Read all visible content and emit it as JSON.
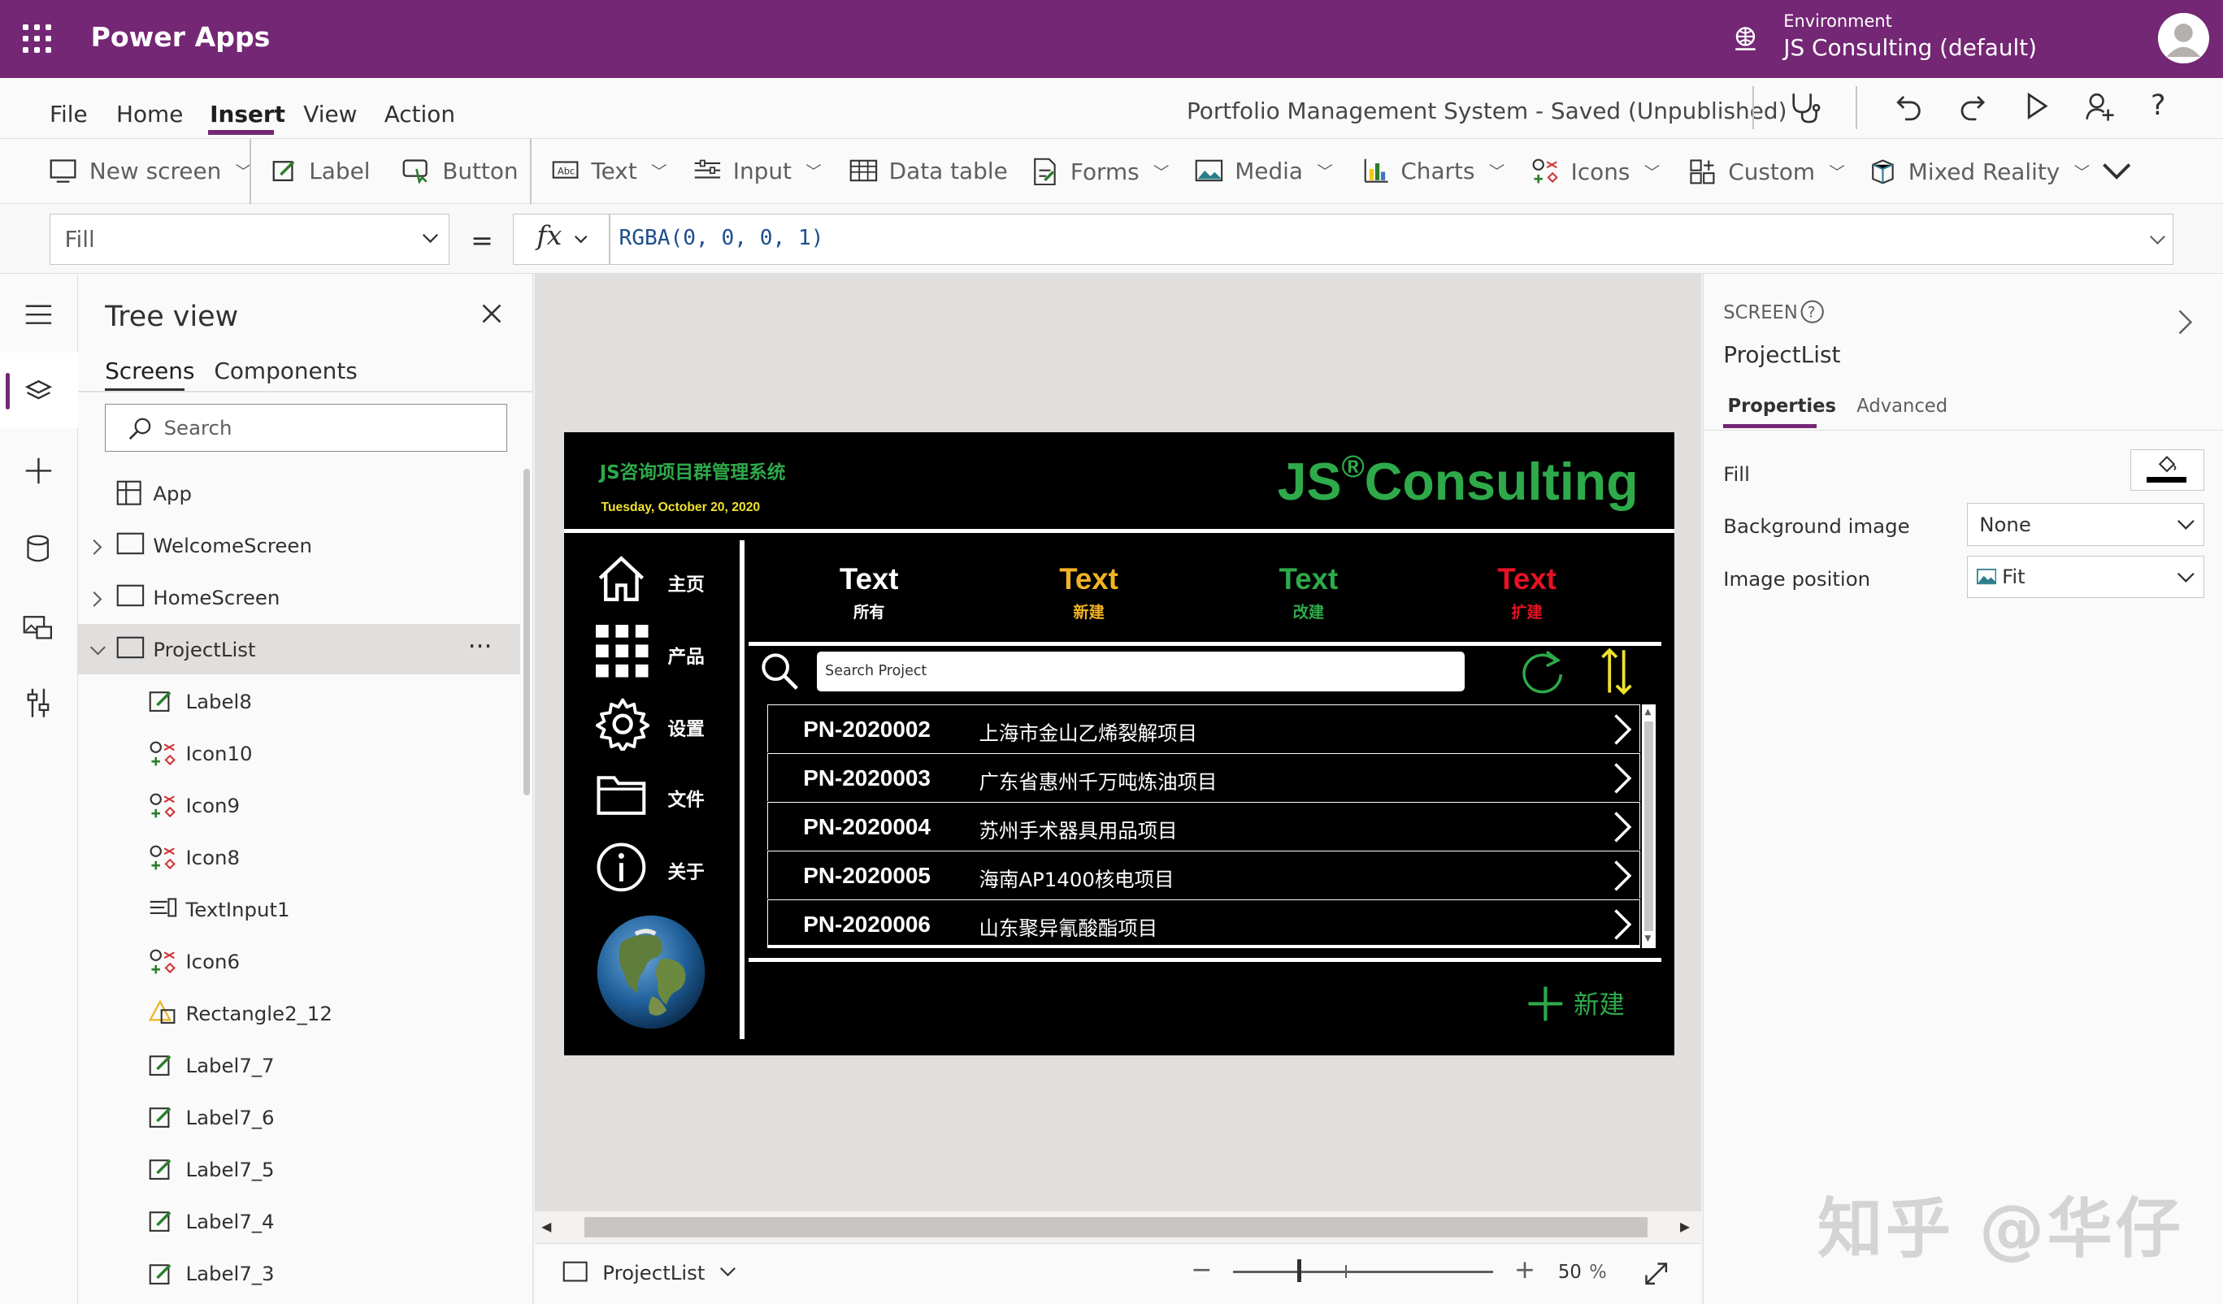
{
  "app": {
    "title": "Power Apps",
    "env_label": "Environment",
    "env_name": "JS Consulting (default)"
  },
  "menu": {
    "items": [
      "File",
      "Home",
      "Insert",
      "View",
      "Action"
    ],
    "active": "Insert",
    "doc_title": "Portfolio Management System - Saved (Unpublished)"
  },
  "ribbon": {
    "new_screen": "New screen",
    "label": "Label",
    "button": "Button",
    "text": "Text",
    "input": "Input",
    "data_table": "Data table",
    "forms": "Forms",
    "media": "Media",
    "charts": "Charts",
    "icons": "Icons",
    "custom": "Custom",
    "mixed_reality": "Mixed Reality"
  },
  "formula": {
    "property": "Fill",
    "eq": "=",
    "fx": "fx",
    "value": "RGBA(0, 0, 0, 1)"
  },
  "tree": {
    "title": "Tree view",
    "tabs": [
      "Screens",
      "Components"
    ],
    "search_placeholder": "Search",
    "items": [
      {
        "name": "App",
        "type": "app",
        "indent": 0
      },
      {
        "name": "WelcomeScreen",
        "type": "screen",
        "indent": 0,
        "expander": "right"
      },
      {
        "name": "HomeScreen",
        "type": "screen",
        "indent": 0,
        "expander": "right"
      },
      {
        "name": "ProjectList",
        "type": "screen",
        "indent": 0,
        "expander": "down",
        "selected": true,
        "more": "···"
      },
      {
        "name": "Label8",
        "type": "label",
        "indent": 1
      },
      {
        "name": "Icon10",
        "type": "icon",
        "indent": 1
      },
      {
        "name": "Icon9",
        "type": "icon",
        "indent": 1
      },
      {
        "name": "Icon8",
        "type": "icon",
        "indent": 1
      },
      {
        "name": "TextInput1",
        "type": "input",
        "indent": 1
      },
      {
        "name": "Icon6",
        "type": "icon",
        "indent": 1
      },
      {
        "name": "Rectangle2_12",
        "type": "shape",
        "indent": 1
      },
      {
        "name": "Label7_7",
        "type": "label",
        "indent": 1
      },
      {
        "name": "Label7_6",
        "type": "label",
        "indent": 1
      },
      {
        "name": "Label7_5",
        "type": "label",
        "indent": 1
      },
      {
        "name": "Label7_4",
        "type": "label",
        "indent": 1
      },
      {
        "name": "Label7_3",
        "type": "label",
        "indent": 1
      }
    ]
  },
  "canvas_app": {
    "header_title": "JS咨询项目群管理系统",
    "header_date": "Tuesday, October 20, 2020",
    "brand_left": "JS",
    "brand_reg": "®",
    "brand_right": "Consulting",
    "nav": [
      {
        "label": "主页",
        "icon": "home-icon"
      },
      {
        "label": "产品",
        "icon": "grid-icon"
      },
      {
        "label": "设置",
        "icon": "gear-icon"
      },
      {
        "label": "文件",
        "icon": "folder-icon"
      },
      {
        "label": "关于",
        "icon": "info-icon"
      }
    ],
    "tabs": [
      {
        "big": "Text",
        "small": "所有",
        "color": "#ffffff"
      },
      {
        "big": "Text",
        "small": "新建",
        "color": "#f0b323"
      },
      {
        "big": "Text",
        "small": "改建",
        "color": "#2eaa4a"
      },
      {
        "big": "Text",
        "small": "扩建",
        "color": "#e81123"
      }
    ],
    "search_placeholder": "Search Project",
    "projects": [
      {
        "id": "PN-2020002",
        "name": "上海市金山乙烯裂解项目"
      },
      {
        "id": "PN-2020003",
        "name": "广东省惠州千万吨炼油项目"
      },
      {
        "id": "PN-2020004",
        "name": "苏州手术器具用品项目"
      },
      {
        "id": "PN-2020005",
        "name": "海南AP1400核电项目"
      },
      {
        "id": "PN-2020006",
        "name": "山东聚异氰酸酯项目"
      }
    ],
    "new_button": "新建"
  },
  "bottom": {
    "screen_name": "ProjectList",
    "zoom": "50",
    "zoom_unit": "%",
    "zoom_minus": "−",
    "zoom_plus": "+"
  },
  "props": {
    "section": "SCREEN",
    "screen_name": "ProjectList",
    "tabs": [
      "Properties",
      "Advanced"
    ],
    "fill_label": "Fill",
    "bg_image_label": "Background image",
    "bg_image_value": "None",
    "img_pos_label": "Image position",
    "img_pos_value": "Fit"
  },
  "watermark": "知乎 @华仔",
  "colors": {
    "brand": "#742774",
    "app_green": "#2eaa4a",
    "app_yellow": "#f0e130"
  }
}
